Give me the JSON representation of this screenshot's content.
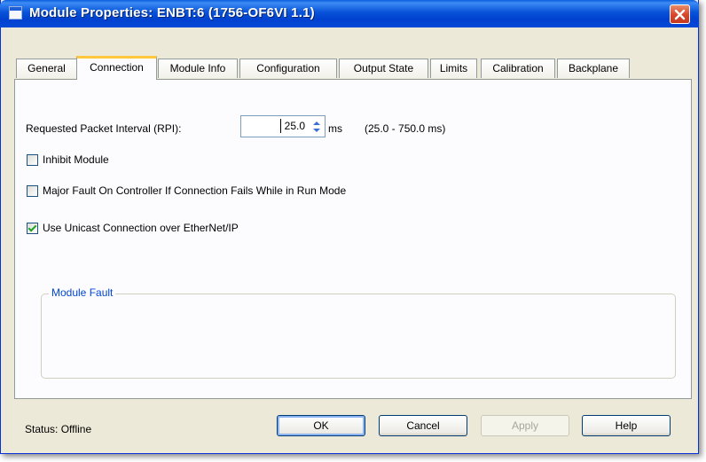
{
  "window": {
    "title": "Module Properties: ENBT:6 (1756-OF6VI 1.1)"
  },
  "tabs": [
    {
      "label": "General"
    },
    {
      "label": "Connection"
    },
    {
      "label": "Module Info"
    },
    {
      "label": "Configuration"
    },
    {
      "label": "Output State"
    },
    {
      "label": "Limits"
    },
    {
      "label": "Calibration"
    },
    {
      "label": "Backplane"
    }
  ],
  "active_tab": "Connection",
  "connection": {
    "rpi_label": "Requested Packet Interval (RPI):",
    "rpi_value": "25.0",
    "rpi_unit": "ms",
    "rpi_range": "(25.0 - 750.0 ms)",
    "inhibit": {
      "label": "Inhibit Module",
      "checked": false
    },
    "major_fault": {
      "label": "Major Fault On Controller If Connection Fails While in Run Mode",
      "checked": false
    },
    "unicast": {
      "label": "Use Unicast Connection over EtherNet/IP",
      "checked": true
    },
    "module_fault_title": "Module Fault"
  },
  "footer": {
    "status": "Status:  Offline",
    "ok": "OK",
    "cancel": "Cancel",
    "apply": "Apply",
    "help": "Help"
  },
  "colors": {
    "titlebar": "#0042cf",
    "accent_tab": "#ffc83c",
    "group_title": "#0046d5",
    "check": "#21a121"
  },
  "icons": {
    "window": "window-icon",
    "close": "close-icon",
    "spin": "spin-updown-icon",
    "check": "checkmark-icon"
  }
}
